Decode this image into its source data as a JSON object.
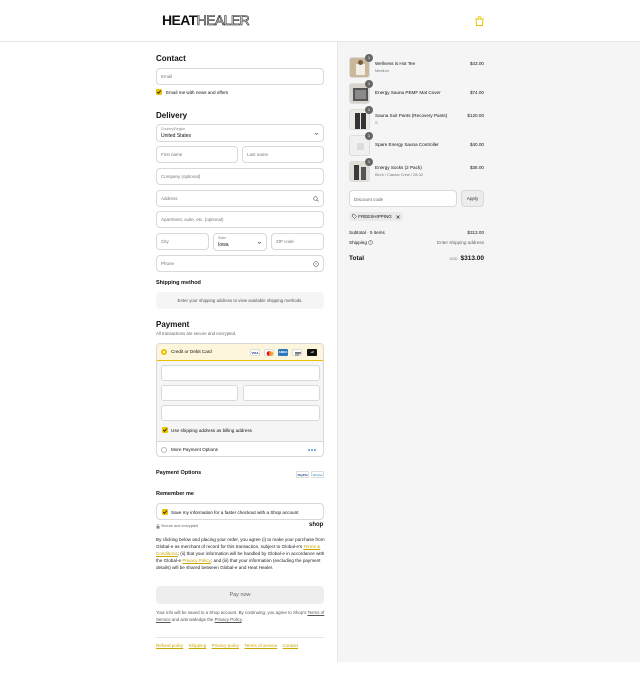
{
  "header": {
    "logo_heat": "HEAT",
    "logo_healer": "HEALER",
    "bag_icon": "shopping-bag-icon"
  },
  "contact": {
    "title": "Contact",
    "email_placeholder": "Email",
    "newsletter_label": "Email me with news and offers"
  },
  "delivery": {
    "title": "Delivery",
    "country_label": "Country/Region",
    "country_value": "United States",
    "first_name": "First name",
    "last_name": "Last name",
    "company": "Company (optional)",
    "address": "Address",
    "apartment": "Apartment, suite, etc. (optional)",
    "city": "City",
    "state_label": "State",
    "state_value": "Iowa",
    "zip": "ZIP code",
    "phone": "Phone"
  },
  "shipping_method": {
    "title": "Shipping method",
    "message": "Enter your shipping address to view available shipping methods."
  },
  "payment": {
    "title": "Payment",
    "subtitle": "All transactions are secure and encrypted.",
    "card_option": "Credit or Debit Card",
    "brands": [
      "VISA",
      "MC",
      "AMEX",
      "DISC",
      "+2"
    ],
    "billing_label": "Use shipping address as billing address",
    "more_options": "More Payment Options",
    "payment_options_title": "Payment Options",
    "paypal": "PayPal",
    "venmo": "Venmo"
  },
  "remember": {
    "title": "Remember me",
    "save_label": "Save my information for a faster checkout with a Shop account",
    "secure_label": "Secure and encrypted",
    "shop_label": "shop",
    "legal_1": "By clicking below and placing your order, you agree (i) to make your purchase from",
    "legal_2": "Global-e as merchant of record for this transaction, subject to Global-e's",
    "legal_link_1": "Terms &",
    "legal_3": "Conditions",
    "legal_4": "; (ii) that your information will be handled by Global-e in accordance with",
    "legal_5": "the Global-e",
    "legal_link_2": "Privacy Policy",
    "legal_6": "; and (iii) that your information (excluding the payment",
    "legal_7": "details) will be shared between Global-e and Heat Healer."
  },
  "pay_button": "Pay now",
  "shop_note_1": "Your info will be saved to a Shop account. By continuing, you agree to Shop's",
  "shop_note_terms": "Terms of Service",
  "shop_note_mid": "and acknowledge the",
  "shop_note_privacy": "Privacy Policy",
  "shop_note_end": ".",
  "footer": [
    "Refund policy",
    "Shipping",
    "Privacy policy",
    "Terms of service",
    "Contact"
  ],
  "cart": {
    "items": [
      {
        "name": "Wellness is Hot Tee",
        "variant": "Medium",
        "qty": "1",
        "price": "$43.00"
      },
      {
        "name": "Energy Sauna PEMF Mat Cover",
        "variant": "",
        "qty": "1",
        "price": "$74.00"
      },
      {
        "name": "Sauna Suit Pants (Recovery Pants)",
        "variant": "S",
        "qty": "1",
        "price": "$120.00"
      },
      {
        "name": "Spare Energy Sauna Controller",
        "variant": "",
        "qty": "1",
        "price": "$40.00"
      },
      {
        "name": "Energy Socks (2 Pack)",
        "variant": "Birch / Classic Crew / 28-32",
        "qty": "1",
        "price": "$36.00"
      }
    ],
    "discount_placeholder": "Discount code",
    "apply_label": "Apply",
    "applied_code": "FREESHIPPING",
    "subtotal_label": "Subtotal · 5 items",
    "subtotal_value": "$313.00",
    "shipping_label": "Shipping",
    "shipping_value": "Enter shipping address",
    "total_label": "Total",
    "currency": "USD",
    "total_value": "$313.00"
  },
  "colors": {
    "accent": "#e8c200",
    "link": "#c9a800",
    "panel": "#f5f5f5"
  }
}
